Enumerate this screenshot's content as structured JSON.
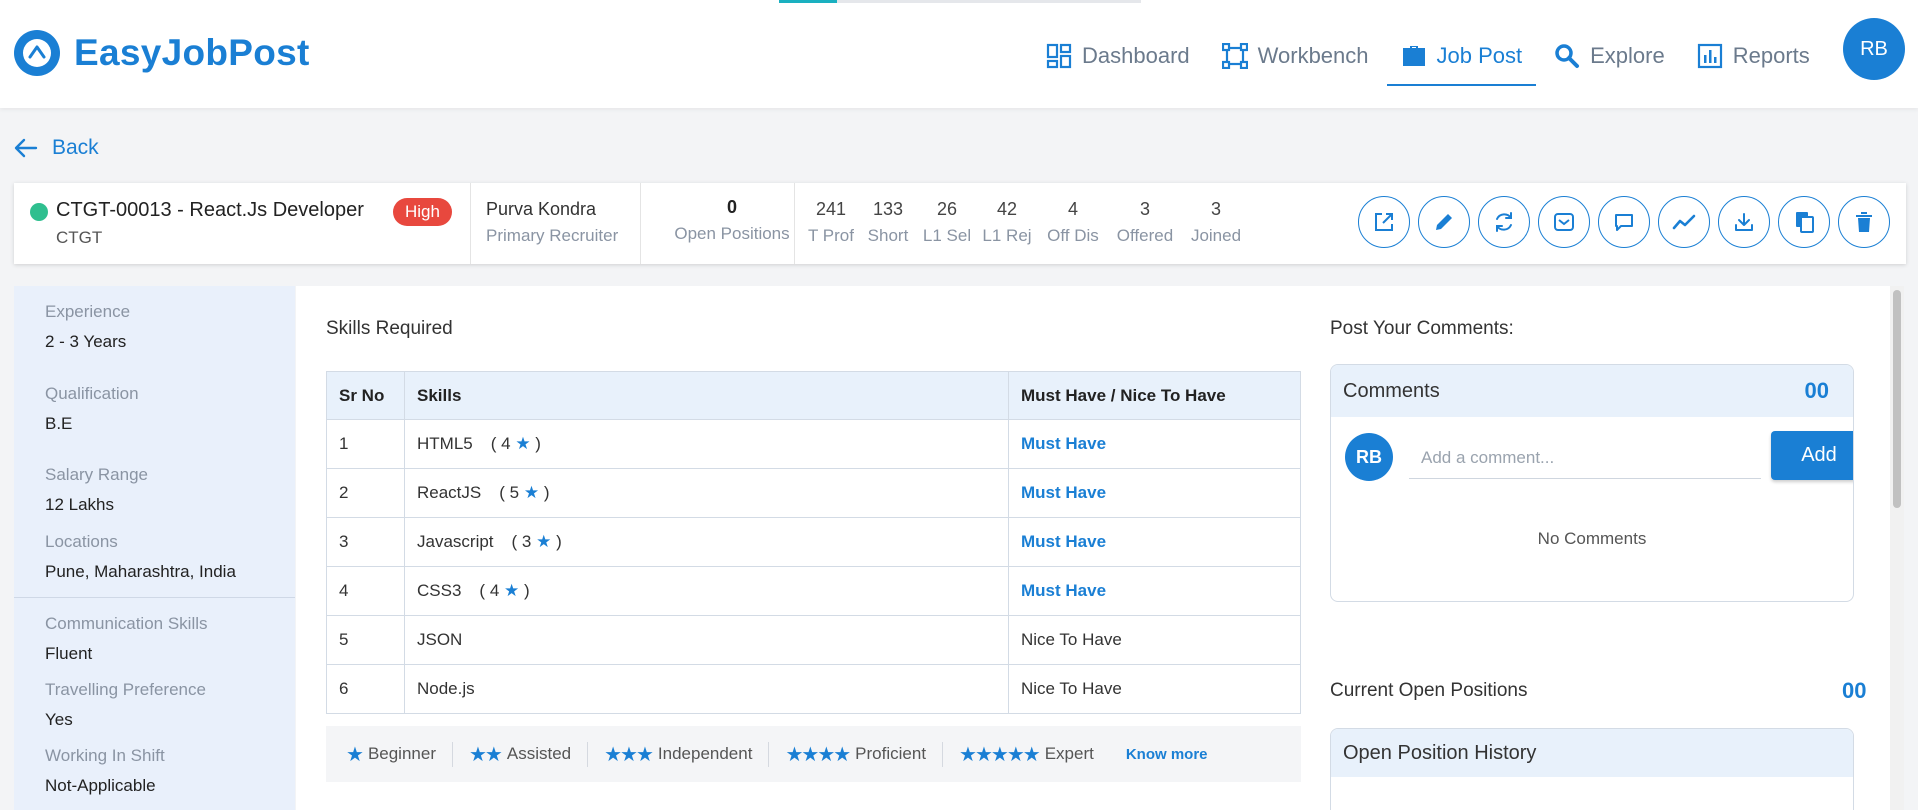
{
  "app": {
    "name": "EasyJobPost"
  },
  "top_progress": {
    "fraction": 0.16
  },
  "nav": {
    "items": [
      {
        "label": "Dashboard",
        "icon": "dashboard-icon",
        "active": false
      },
      {
        "label": "Workbench",
        "icon": "workbench-icon",
        "active": false
      },
      {
        "label": "Job Post",
        "icon": "briefcase-icon",
        "active": true
      },
      {
        "label": "Explore",
        "icon": "search-icon",
        "active": false
      },
      {
        "label": "Reports",
        "icon": "reports-icon",
        "active": false
      }
    ],
    "user_initials": "RB"
  },
  "back_label": "Back",
  "job": {
    "title": "CTGT-00013 - React.Js Developer",
    "client": "CTGT",
    "priority": "High",
    "status_color": "#2fbf8f",
    "recruiter": {
      "name": "Purva Kondra",
      "role": "Primary Recruiter"
    },
    "open_positions": {
      "value": "0",
      "label": "Open Positions"
    },
    "stats": [
      {
        "value": "241",
        "label": "T Prof"
      },
      {
        "value": "133",
        "label": "Short"
      },
      {
        "value": "26",
        "label": "L1 Sel"
      },
      {
        "value": "42",
        "label": "L1 Rej"
      },
      {
        "value": "4",
        "label": "Off Dis"
      },
      {
        "value": "3",
        "label": "Offered"
      },
      {
        "value": "3",
        "label": "Joined"
      }
    ],
    "actions": [
      "open-external-icon",
      "edit-icon",
      "sync-icon",
      "mail-icon",
      "chat-icon",
      "trend-icon",
      "download-icon",
      "copy-icon",
      "delete-icon"
    ]
  },
  "details": [
    {
      "label": "Experience",
      "value": "2 - 3 Years"
    },
    {
      "label": "Qualification",
      "value": "B.E"
    },
    {
      "label": "Salary Range",
      "value": "12 Lakhs"
    },
    {
      "label": "Locations",
      "value": "Pune, Maharashtra, India"
    },
    {
      "label": "Communication Skills",
      "value": "Fluent"
    },
    {
      "label": "Travelling Preference",
      "value": "Yes"
    },
    {
      "label": "Working In Shift",
      "value": "Not-Applicable"
    }
  ],
  "skills": {
    "title": "Skills Required",
    "headers": [
      "Sr No",
      "Skills",
      "Must Have / Nice To Have"
    ],
    "rows": [
      {
        "sr": "1",
        "skill": "HTML5",
        "rating": "4",
        "type": "Must Have",
        "must": true
      },
      {
        "sr": "2",
        "skill": "ReactJS",
        "rating": "5",
        "type": "Must Have",
        "must": true
      },
      {
        "sr": "3",
        "skill": "Javascript",
        "rating": "3",
        "type": "Must Have",
        "must": true
      },
      {
        "sr": "4",
        "skill": "CSS3",
        "rating": "4",
        "type": "Must Have",
        "must": true
      },
      {
        "sr": "5",
        "skill": "JSON",
        "rating": "",
        "type": "Nice To Have",
        "must": false
      },
      {
        "sr": "6",
        "skill": "Node.js",
        "rating": "",
        "type": "Nice To Have",
        "must": false
      }
    ],
    "legend": [
      {
        "stars": 1,
        "label": "Beginner"
      },
      {
        "stars": 2,
        "label": "Assisted"
      },
      {
        "stars": 3,
        "label": "Independent"
      },
      {
        "stars": 4,
        "label": "Proficient"
      },
      {
        "stars": 5,
        "label": "Expert"
      }
    ],
    "know_more": "Know more"
  },
  "comments": {
    "section_title": "Post Your Comments:",
    "title": "Comments",
    "count": "00",
    "avatar": "RB",
    "placeholder": "Add a comment...",
    "add_label": "Add",
    "empty": "No Comments"
  },
  "open_positions": {
    "title": "Current Open Positions",
    "count": "00",
    "history_title": "Open Position History"
  },
  "colors": {
    "accent": "#1a7fd4",
    "priority_high": "#e8483e"
  }
}
